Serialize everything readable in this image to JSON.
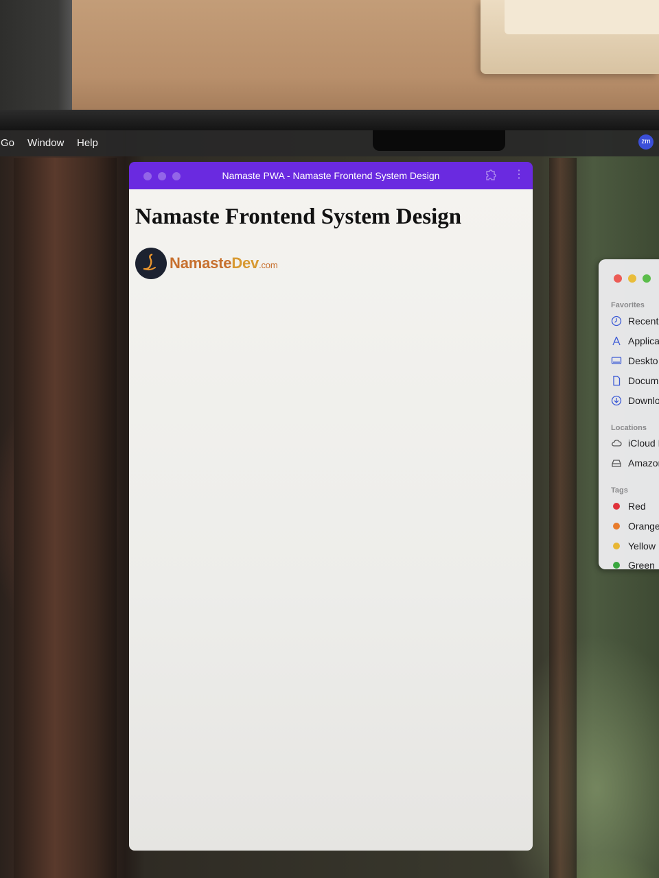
{
  "menubar": {
    "items": [
      "Go",
      "Window",
      "Help"
    ],
    "avatar_initials": "zm"
  },
  "pwa_window": {
    "title": "Namaste PWA - Namaste Frontend System Design",
    "accent_color": "#6a2ae0",
    "heading": "Namaste Frontend System Design",
    "logo": {
      "part1": "Namaste",
      "part2": "Dev",
      "part3": ".com"
    }
  },
  "finder_sidebar": {
    "favorites_label": "Favorites",
    "favorites": [
      {
        "label": "Recent",
        "icon": "clock-icon"
      },
      {
        "label": "Applica",
        "icon": "applications-icon"
      },
      {
        "label": "Deskto",
        "icon": "desktop-icon"
      },
      {
        "label": "Docum",
        "icon": "document-icon"
      },
      {
        "label": "Downlo",
        "icon": "download-icon"
      }
    ],
    "locations_label": "Locations",
    "locations": [
      {
        "label": "iCloud D",
        "icon": "cloud-icon"
      },
      {
        "label": "Amazon",
        "icon": "drive-icon"
      }
    ],
    "tags_label": "Tags",
    "tags": [
      {
        "label": "Red",
        "color": "#e0313a"
      },
      {
        "label": "Orange",
        "color": "#e87b2c"
      },
      {
        "label": "Yellow",
        "color": "#e8b634"
      },
      {
        "label": "Green",
        "color": "#3aa83f"
      }
    ]
  }
}
